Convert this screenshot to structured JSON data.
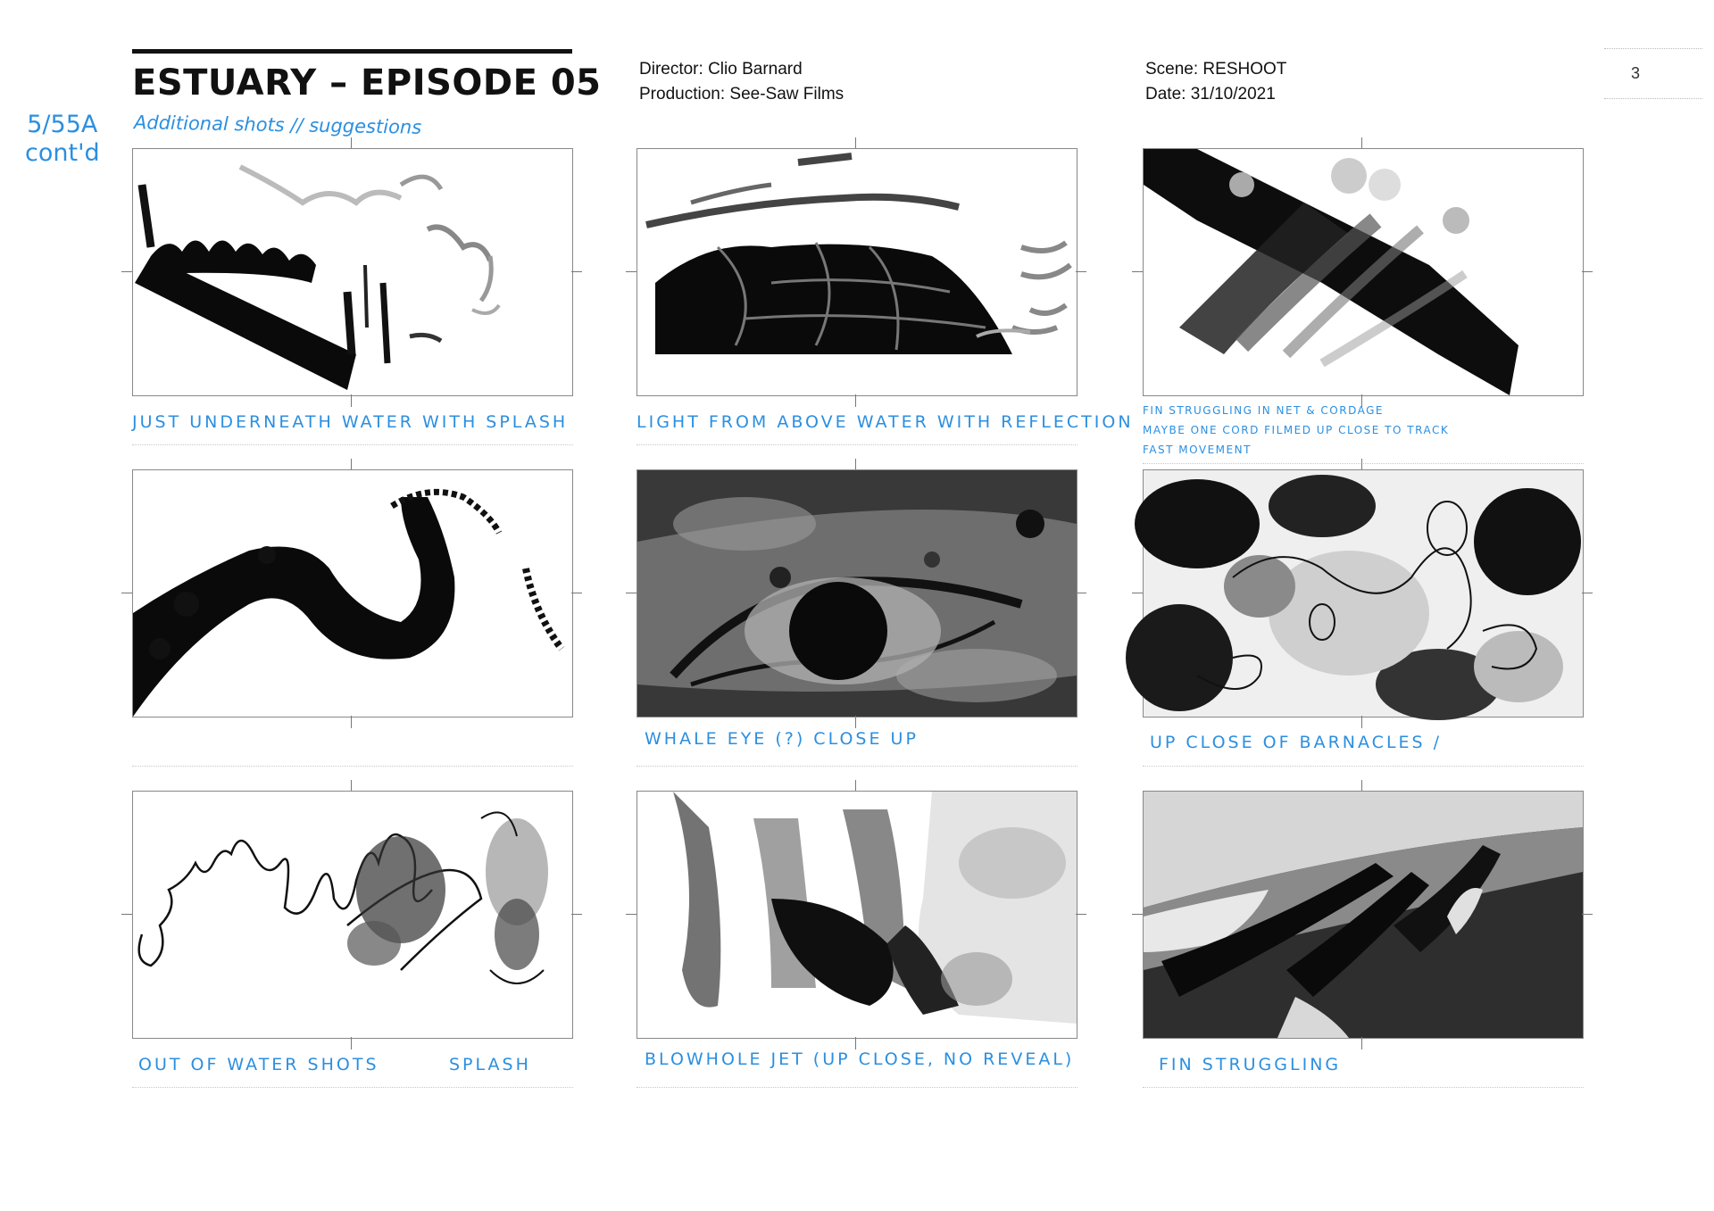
{
  "header": {
    "title": "ESTUARY – EPISODE 05",
    "subtitle": "Additional shots // suggestions",
    "scene_ref_line1": "5/55A",
    "scene_ref_line2": "cont'd",
    "director": "Director: Clio Barnard",
    "production": "Production: See-Saw Films",
    "scene": "Scene: RESHOOT",
    "date": "Date: 31/10/2021",
    "page_number": "3"
  },
  "panels": [
    {
      "caption": "JUST UNDERNEATH WATER WITH SPLASH"
    },
    {
      "caption": "LIGHT FROM ABOVE WATER WITH REFLECTION"
    },
    {
      "caption_lines": [
        "FIN STRUGGLING IN NET & CORDAGE",
        "MAYBE ONE CORD FILMED UP CLOSE TO TRACK",
        "FAST MOVEMENT"
      ]
    },
    {
      "caption": ""
    },
    {
      "caption": "WHALE EYE (?) CLOSE UP"
    },
    {
      "caption": "UP CLOSE OF BARNACLES /"
    },
    {
      "caption_a": "OUT OF WATER SHOTS",
      "caption_b": "SPLASH"
    },
    {
      "caption": "BLOWHOLE JET (UP CLOSE, NO REVEAL)"
    },
    {
      "caption": "FIN STRUGGLING"
    }
  ],
  "colors": {
    "annotation_blue": "#2b8fe0",
    "ink": "#111111"
  }
}
